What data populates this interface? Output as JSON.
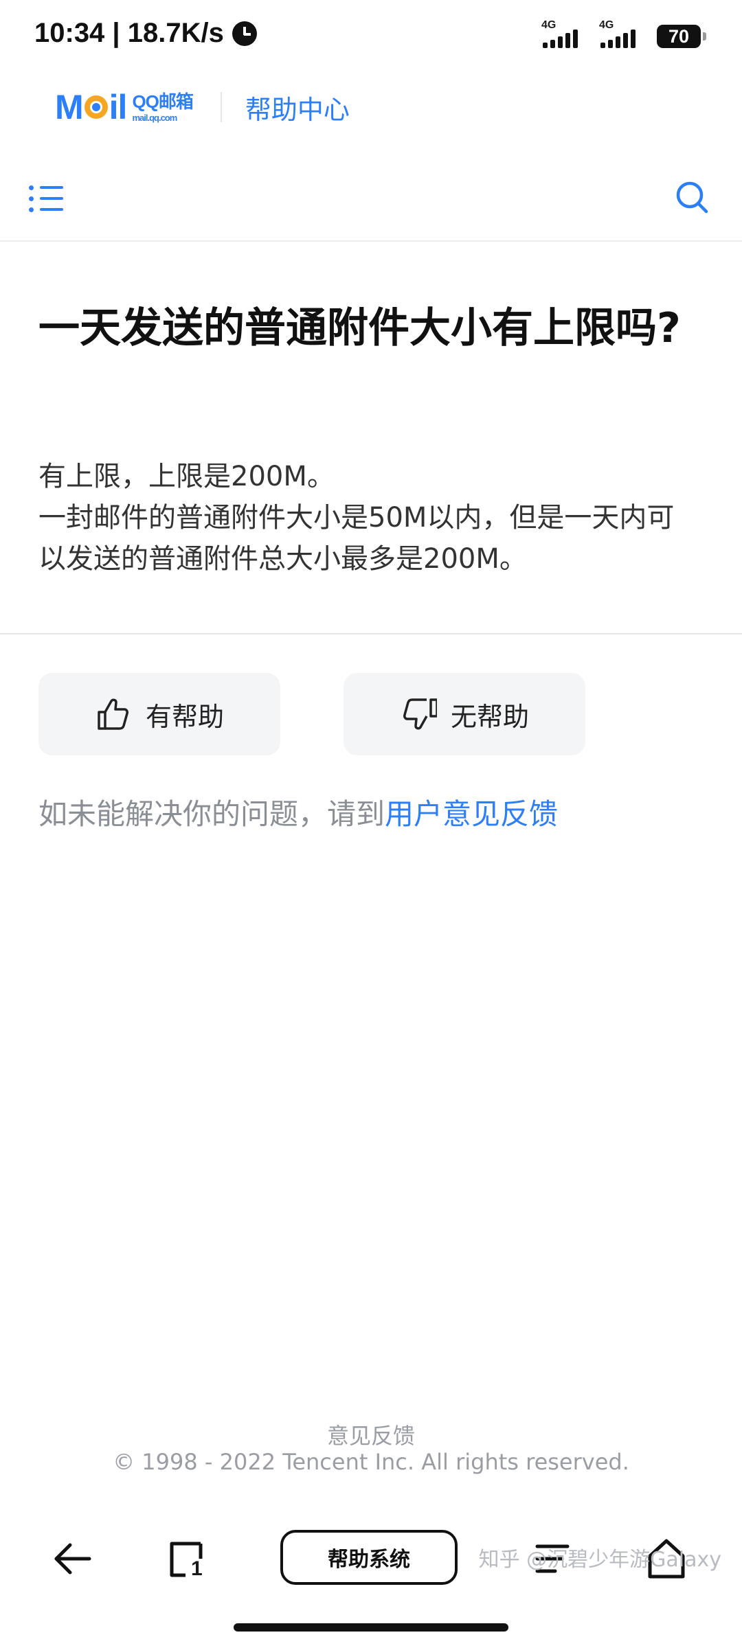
{
  "status_bar": {
    "time_speed": "10:34 | 18.7K/s",
    "signal1_label": "4G",
    "signal2_label": "4G",
    "battery": "70"
  },
  "brand": {
    "logo_mail_m": "M",
    "logo_mail_il": "il",
    "logo_qq": "QQ邮箱",
    "logo_url": "mail.qq.com",
    "title": "帮助中心"
  },
  "article": {
    "title": "一天发送的普通附件大小有上限吗?",
    "body_line1": "有上限，上限是200M。",
    "body_line2": "一封邮件的普通附件大小是50M以内，但是一天内可以发送的普通附件总大小最多是200M。"
  },
  "feedback": {
    "helpful_label": "有帮助",
    "not_helpful_label": "无帮助",
    "prompt_text": "如未能解决你的问题，请到",
    "link_text": "用户意见反馈"
  },
  "footer": {
    "feedback_link": "意见反馈",
    "copyright": "© 1998 - 2022 Tencent Inc. All rights reserved."
  },
  "bottom_bar": {
    "center_label": "帮助系统",
    "tabs_count": "1"
  },
  "watermark": "知乎 @沉碧少年游Galaxy",
  "colors": {
    "accent": "#2d7ff9",
    "muted_text": "#8a8f96",
    "button_bg": "#f4f5f7"
  }
}
